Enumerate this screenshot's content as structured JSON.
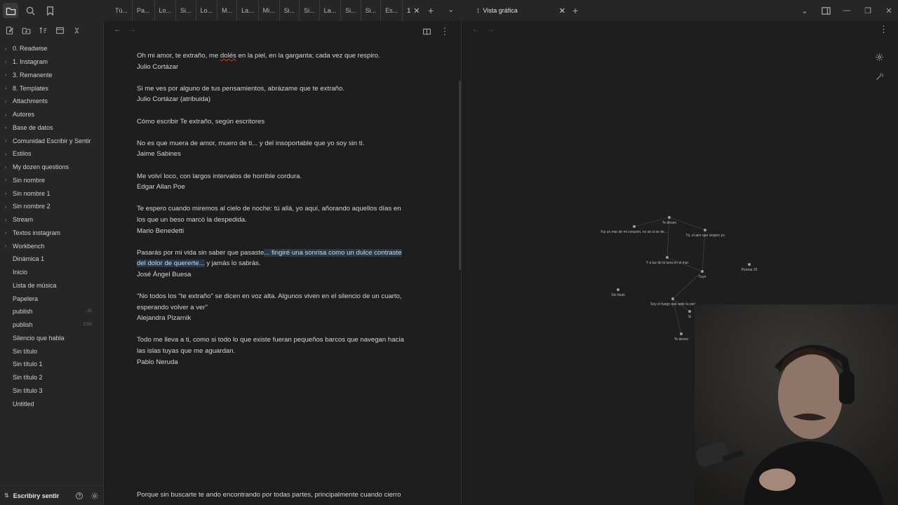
{
  "ribbon": {
    "icons": [
      "folder-icon",
      "search-icon",
      "bookmark-icon"
    ]
  },
  "sidebar": {
    "actions": [
      "new-note-icon",
      "new-folder-icon",
      "sort-icon",
      "collapse-icon",
      "close-icon"
    ],
    "items": [
      {
        "label": "0. Readwise",
        "type": "folder"
      },
      {
        "label": "1. Instagram",
        "type": "folder"
      },
      {
        "label": "3. Remanente",
        "type": "folder"
      },
      {
        "label": "8. Templates",
        "type": "folder"
      },
      {
        "label": "Attachments",
        "type": "folder"
      },
      {
        "label": "Autores",
        "type": "folder"
      },
      {
        "label": "Base de datos",
        "type": "folder"
      },
      {
        "label": "Comunidad Escribir y Sentir",
        "type": "folder"
      },
      {
        "label": "Estilos",
        "type": "folder"
      },
      {
        "label": "My dozen questions",
        "type": "folder"
      },
      {
        "label": "Sin nombre",
        "type": "folder"
      },
      {
        "label": "Sin nombre 1",
        "type": "folder"
      },
      {
        "label": "Sin nombre 2",
        "type": "folder"
      },
      {
        "label": "Stream",
        "type": "folder"
      },
      {
        "label": "Textos instagram",
        "type": "folder"
      },
      {
        "label": "Workbench",
        "type": "folder"
      },
      {
        "label": "Dinámica 1",
        "type": "file"
      },
      {
        "label": "Inicio",
        "type": "file"
      },
      {
        "label": "Lista de música",
        "type": "file"
      },
      {
        "label": "Papelera",
        "type": "file"
      },
      {
        "label": "publish",
        "type": "file",
        "ext": "JS"
      },
      {
        "label": "publish",
        "type": "file",
        "ext": "CSS"
      },
      {
        "label": "Silencio que habla",
        "type": "file"
      },
      {
        "label": "Sin título",
        "type": "file"
      },
      {
        "label": "Sin título 1",
        "type": "file"
      },
      {
        "label": "Sin título 2",
        "type": "file"
      },
      {
        "label": "Sin título 3",
        "type": "file"
      },
      {
        "label": "Untitled",
        "type": "file"
      }
    ],
    "vault_name": "Escribiry sentir"
  },
  "tabs": {
    "items": [
      "Tú...",
      "Pa...",
      "Lo...",
      "Si...",
      "Lo...",
      "M...",
      "La...",
      "Mi...",
      "Si...",
      "Si...",
      "La...",
      "Si...",
      "Si...",
      "Es...",
      "1"
    ],
    "graph_tab_label": "Vista gráfica"
  },
  "editor": {
    "paragraphs": [
      {
        "lines": [
          "Oh mi amor, te extraño, me dolés en la piel, en la garganta; cada vez que respiro.",
          "Julio Cortázar"
        ]
      },
      {
        "lines": [
          "Si me ves por alguno de tus pensamientos, abrázame que te extraño.",
          "Julio Cortázar (atribuida)"
        ]
      },
      {
        "lines": [
          "",
          "",
          ""
        ]
      },
      {
        "lines": [
          "Cómo escribir Te extraño, según escritores"
        ]
      },
      {
        "lines": [
          "No es que muera de amor, muero de ti... y del insoportable que yo soy sin ti.",
          "Jaime Sabines"
        ]
      },
      {
        "lines": [
          "Me volví loco, con largos intervalos de horrible cordura.",
          "Edgar Allan Poe"
        ]
      },
      {
        "lines": [
          "Te espero cuando miremos al cielo de noche: tú allá, yo aquí, añorando aquellos días en",
          "los que un beso marcó la despedida.",
          "Mario Benedetti"
        ]
      },
      {
        "lines": [
          "Pasarás por mi vida sin saber que pasaste... fingiré una sonrisa como un dulce contraste",
          "del dolor de quererte... y jamás lo sabrás.",
          "José Ángel Buesa"
        ]
      },
      {
        "lines": [
          "\"No todos los \"te extraño\" se dicen en voz alta. Algunos viven en el silencio de un cuarto,",
          "esperando volver a ver\"",
          "Alejandra Pizarnik"
        ]
      },
      {
        "lines": [
          "Todo me lleva a ti, como si todo lo que existe fueran pequeños barcos que navegan hacia",
          "las islas tuyas que me aguardan.",
          "Pablo Neruda"
        ]
      }
    ],
    "bottom_line": "Porque sin buscarte te ando encontrando por todas partes, principalmente cuando cierro"
  },
  "graph": {
    "nodes": [
      {
        "label": "Te deseo"
      },
      {
        "label": "Fui un mar de mi corazón, no sé si se detuvo en el pecho o vaya al rededor de este"
      },
      {
        "label": "Tú, el aire que respiro yo"
      },
      {
        "label": "Y a luz de la luna en el mar"
      },
      {
        "label": "Tuyo"
      },
      {
        "label": "Poema 20"
      },
      {
        "label": "Sin título"
      },
      {
        "label": "Soy el fuego que arde tu piel"
      },
      {
        "label": "Si"
      },
      {
        "label": "Te deseo"
      }
    ]
  },
  "colors": {
    "background": "#1e1e1e",
    "sidebar": "#262626",
    "highlight": "#26394c",
    "spellcheck": "#c83a3a"
  }
}
